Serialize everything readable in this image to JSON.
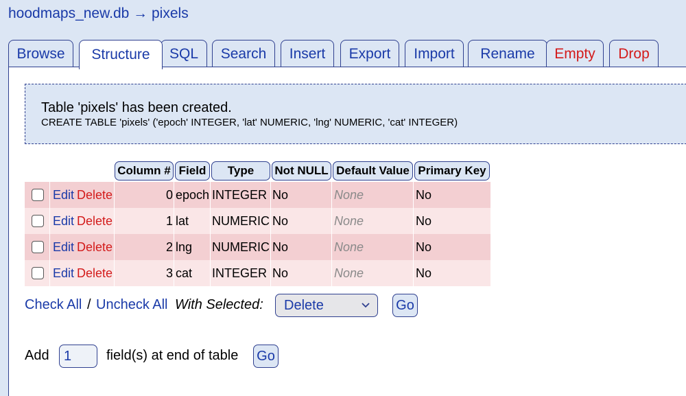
{
  "breadcrumb": {
    "db": "hoodmaps_new.db",
    "arrow": "→",
    "table": "pixels"
  },
  "tabs": [
    {
      "label": "Browse",
      "active": false,
      "danger": false
    },
    {
      "label": "Structure",
      "active": true,
      "danger": false
    },
    {
      "label": "SQL",
      "active": false,
      "danger": false
    },
    {
      "label": "Search",
      "active": false,
      "danger": false
    },
    {
      "label": "Insert",
      "active": false,
      "danger": false
    },
    {
      "label": "Export",
      "active": false,
      "danger": false
    },
    {
      "label": "Import",
      "active": false,
      "danger": false
    },
    {
      "label": "Rename",
      "active": false,
      "danger": false
    },
    {
      "label": "Empty",
      "active": false,
      "danger": true
    },
    {
      "label": "Drop",
      "active": false,
      "danger": true
    }
  ],
  "message": {
    "title": "Table 'pixels' has been created.",
    "sql": "CREATE TABLE 'pixels' ('epoch' INTEGER, 'lat' NUMERIC, 'lng' NUMERIC, 'cat' INTEGER)"
  },
  "table": {
    "headers": [
      "Column #",
      "Field",
      "Type",
      "Not NULL",
      "Default Value",
      "Primary Key"
    ],
    "edit_label": "Edit",
    "delete_label": "Delete",
    "rows": [
      {
        "num": "0",
        "field": "epoch",
        "type": "INTEGER",
        "not_null": "No",
        "default": "None",
        "pk": "No"
      },
      {
        "num": "1",
        "field": "lat",
        "type": "NUMERIC",
        "not_null": "No",
        "default": "None",
        "pk": "No"
      },
      {
        "num": "2",
        "field": "lng",
        "type": "NUMERIC",
        "not_null": "No",
        "default": "None",
        "pk": "No"
      },
      {
        "num": "3",
        "field": "cat",
        "type": "INTEGER",
        "not_null": "No",
        "default": "None",
        "pk": "No"
      }
    ]
  },
  "actions": {
    "check_all": "Check All",
    "separator": "/",
    "uncheck_all": "Uncheck All",
    "with_selected": "With Selected:",
    "selected_action": "Delete",
    "go": "Go"
  },
  "add_field": {
    "prefix": "Add",
    "count": "1",
    "suffix": "field(s) at end of table",
    "go": "Go"
  }
}
